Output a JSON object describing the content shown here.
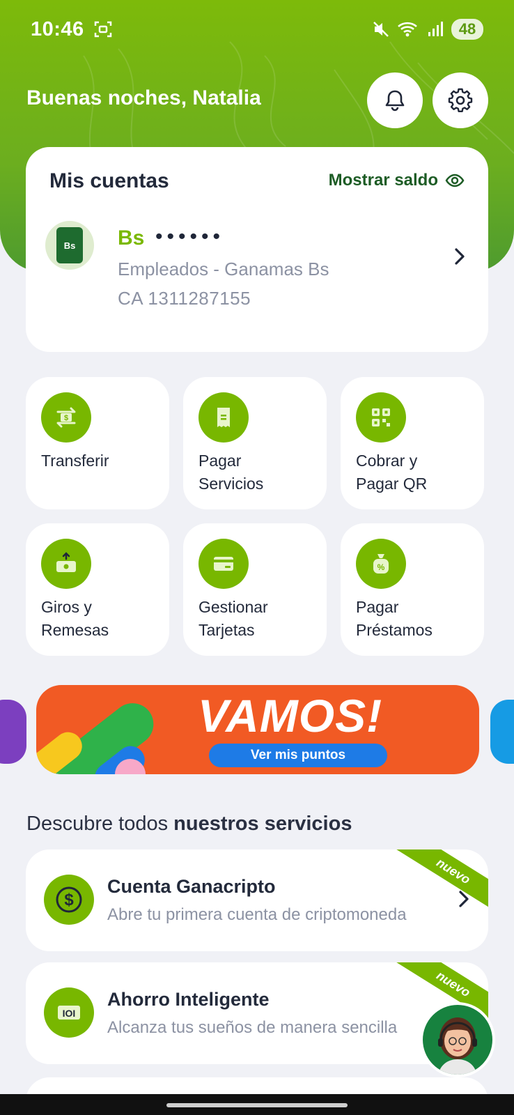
{
  "status_bar": {
    "time": "10:46",
    "battery": "48"
  },
  "header": {
    "greeting": "Buenas noches, Natalia"
  },
  "accounts": {
    "title": "Mis cuentas",
    "show_balance": "Mostrar saldo",
    "account": {
      "avatar_text": "Bs",
      "currency": "Bs",
      "masked_balance": "••••••",
      "name": "Empleados - Ganamas  Bs",
      "number": "CA  1311287155"
    }
  },
  "actions": [
    {
      "line1": "Transferir",
      "line2": ""
    },
    {
      "line1": "Pagar",
      "line2": "Servicios"
    },
    {
      "line1": "Cobrar y",
      "line2": "Pagar QR"
    },
    {
      "line1": "Giros y",
      "line2": "Remesas"
    },
    {
      "line1": "Gestionar",
      "line2": "Tarjetas"
    },
    {
      "line1": "Pagar",
      "line2": "Préstamos"
    }
  ],
  "banner": {
    "title": "VAMOS!",
    "button": "Ver mis puntos"
  },
  "services_section": {
    "title_normal": "Descubre todos ",
    "title_bold": "nuestros servicios",
    "items": [
      {
        "title": "Cuenta Ganacripto",
        "desc": "Abre tu primera cuenta de criptomoneda",
        "badge": "nuevo"
      },
      {
        "title": "Ahorro Inteligente",
        "desc": "Alcanza tus sueños de manera sencilla",
        "badge": "nuevo"
      }
    ]
  },
  "colors": {
    "brand_green": "#78b700",
    "dark_green": "#1d5c25",
    "banner_orange": "#f15a24"
  }
}
